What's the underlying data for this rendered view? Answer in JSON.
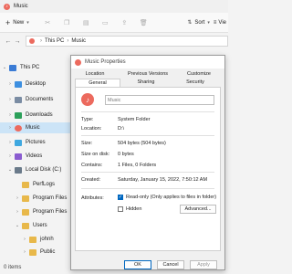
{
  "window": {
    "title": "Music"
  },
  "toolbar": {
    "new_label": "New",
    "sort_label": "Sort",
    "view_label": "Vie"
  },
  "address": {
    "crumbs": [
      "This PC",
      "Music"
    ]
  },
  "sidebar": {
    "items": [
      {
        "label": "This PC",
        "icon": "pc-icon",
        "level": 0,
        "expanded": true
      },
      {
        "label": "Desktop",
        "icon": "desktop-icon",
        "level": 1
      },
      {
        "label": "Documents",
        "icon": "documents-icon",
        "level": 1
      },
      {
        "label": "Downloads",
        "icon": "downloads-icon",
        "level": 1
      },
      {
        "label": "Music",
        "icon": "music-icon",
        "level": 1,
        "selected": true
      },
      {
        "label": "Pictures",
        "icon": "pictures-icon",
        "level": 1
      },
      {
        "label": "Videos",
        "icon": "videos-icon",
        "level": 1
      },
      {
        "label": "Local Disk (C:)",
        "icon": "disk-icon",
        "level": 1,
        "expanded": true
      },
      {
        "label": "PerfLogs",
        "icon": "folder-icon",
        "level": 2
      },
      {
        "label": "Program Files",
        "icon": "folder-icon",
        "level": 2
      },
      {
        "label": "Program Files",
        "icon": "folder-icon",
        "level": 2
      },
      {
        "label": "Users",
        "icon": "folder-icon",
        "level": 2,
        "expanded": true
      },
      {
        "label": "johnh",
        "icon": "folder-icon",
        "level": 3
      },
      {
        "label": "Public",
        "icon": "folder-icon",
        "level": 3
      }
    ]
  },
  "status": {
    "text": "0 items"
  },
  "dialog": {
    "title": "Music Properties",
    "tabs_row1": [
      "Location",
      "Previous Versions",
      "Customize"
    ],
    "tabs_row2": [
      "General",
      "Sharing",
      "Security"
    ],
    "active_tab": "General",
    "name_value": "Music",
    "props": [
      {
        "label": "Type:",
        "value": "System Folder"
      },
      {
        "label": "Location:",
        "value": "D:\\"
      },
      {
        "label": "Size:",
        "value": "504 bytes (504 bytes)"
      },
      {
        "label": "Size on disk:",
        "value": "0 bytes"
      },
      {
        "label": "Contains:",
        "value": "1 Files, 0 Folders"
      },
      {
        "label": "Created:",
        "value": "Saturday, January 15, 2022, 7:50:12 AM"
      }
    ],
    "attributes_label": "Attributes:",
    "readonly_label": "Read-only (Only applies to files in folder)",
    "hidden_label": "Hidden",
    "advanced_label": "Advanced...",
    "ok_label": "OK",
    "cancel_label": "Cancel",
    "apply_label": "Apply",
    "accent_color": "#0067c0"
  }
}
